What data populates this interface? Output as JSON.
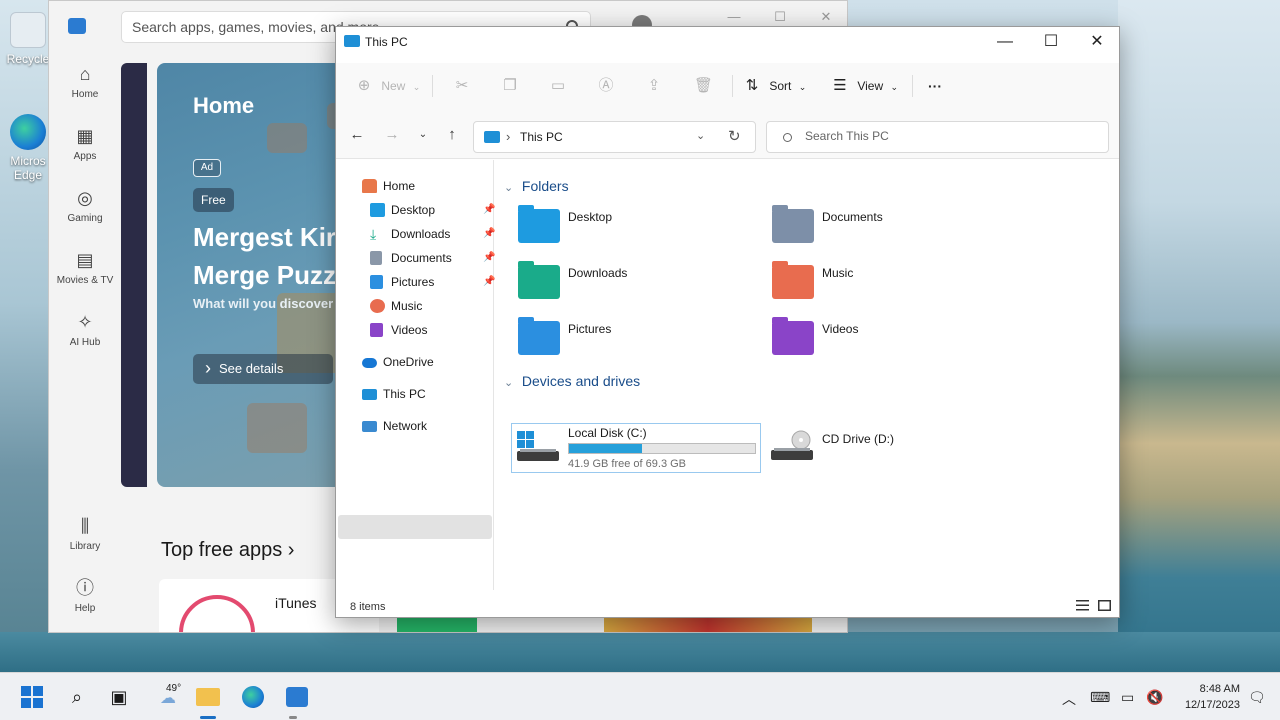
{
  "desktop": {
    "icons": [
      {
        "label": "Recycle"
      },
      {
        "label": "Micros\nEdge"
      }
    ]
  },
  "store": {
    "search_placeholder": "Search apps, games, movies, and more",
    "nav": [
      {
        "label": "Home",
        "icon": "home-icon"
      },
      {
        "label": "Apps",
        "icon": "apps-icon"
      },
      {
        "label": "Gaming",
        "icon": "gaming-icon"
      },
      {
        "label": "Movies & TV",
        "icon": "movies-icon"
      },
      {
        "label": "AI Hub",
        "icon": "ai-hub-icon"
      },
      {
        "label": "Library",
        "icon": "library-icon"
      },
      {
        "label": "Help",
        "icon": "help-icon"
      }
    ],
    "hero": {
      "title": "Home",
      "ad_badge": "Ad",
      "price_badge": "Free",
      "app_name": "Mergest Kir\nMerge Puzz",
      "app_desc": "What will you discover",
      "details_button": "See details"
    },
    "top_free_heading": "Top free apps ›",
    "top_app_name": "iTunes"
  },
  "explorer": {
    "title": "This PC",
    "toolbar": {
      "new_label": "New",
      "sort_label": "Sort",
      "view_label": "View",
      "more_label": "···"
    },
    "address": {
      "path": "This PC",
      "search_placeholder": "Search This PC"
    },
    "sidebar": [
      {
        "label": "Home",
        "icon": "home-icon",
        "pinned": false
      },
      {
        "label": "Desktop",
        "icon": "desktop-folder-icon",
        "pinned": true
      },
      {
        "label": "Downloads",
        "icon": "downloads-folder-icon",
        "pinned": true
      },
      {
        "label": "Documents",
        "icon": "documents-folder-icon",
        "pinned": true
      },
      {
        "label": "Pictures",
        "icon": "pictures-folder-icon",
        "pinned": true
      },
      {
        "label": "Music",
        "icon": "music-folder-icon",
        "pinned": false
      },
      {
        "label": "Videos",
        "icon": "videos-folder-icon",
        "pinned": false
      },
      {
        "label": "OneDrive",
        "icon": "onedrive-icon",
        "pinned": false
      },
      {
        "label": "This PC",
        "icon": "this-pc-icon",
        "pinned": false,
        "selected": true
      },
      {
        "label": "Network",
        "icon": "network-icon",
        "pinned": false
      }
    ],
    "folders_heading": "Folders",
    "folders": [
      {
        "name": "Desktop",
        "icon": "desktop-folder-icon",
        "color": "#1e9be0"
      },
      {
        "name": "Documents",
        "icon": "documents-folder-icon",
        "color": "#7d8fa8"
      },
      {
        "name": "Downloads",
        "icon": "downloads-folder-icon",
        "color": "#1aab8a"
      },
      {
        "name": "Music",
        "icon": "music-folder-icon",
        "color": "#e86c4f"
      },
      {
        "name": "Pictures",
        "icon": "pictures-folder-icon",
        "color": "#2b8fe0"
      },
      {
        "name": "Videos",
        "icon": "videos-folder-icon",
        "color": "#8a44c8"
      }
    ],
    "drives_heading": "Devices and drives",
    "drives": [
      {
        "name": "Local Disk (C:)",
        "free_text": "41.9 GB free of 69.3 GB",
        "used_fraction": 0.395,
        "icon": "local-disk-icon"
      },
      {
        "name": "CD Drive (D:)",
        "icon": "cd-drive-icon"
      }
    ],
    "status": "8 items"
  },
  "taskbar": {
    "weather_temp": "49°",
    "time": "8:48 AM",
    "date": "12/17/2023"
  }
}
